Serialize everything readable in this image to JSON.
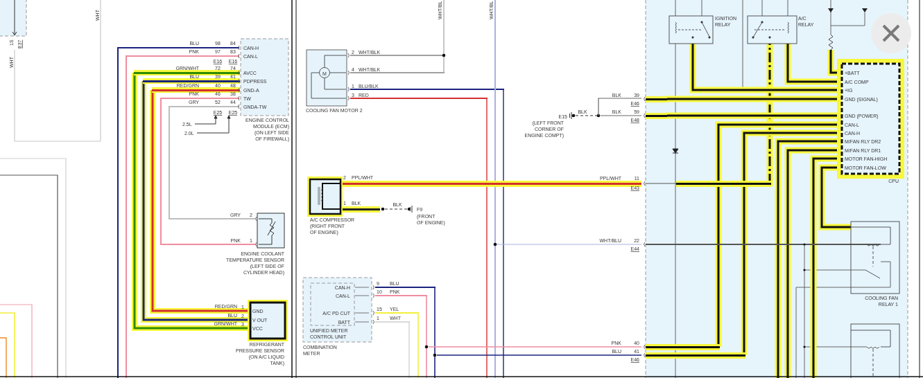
{
  "left_stub": {
    "pin": "1S",
    "connector": "E37",
    "wire_labels": [
      "WHT",
      "WHT"
    ]
  },
  "ecm": {
    "title": "ENGINE CONTROL\nMODULE (ECM)\n(ON LEFT SIDE\nOF FIREWALL)",
    "connectors_upper": [
      "E16",
      "E16"
    ],
    "connectors_lower": [
      "E25",
      "E25"
    ],
    "engine_variants": [
      "2.5L",
      "2.0L"
    ],
    "terminals": [
      {
        "name": "CAN-H",
        "wire": "BLU",
        "pin_harness": "98",
        "pin_module": "84",
        "color": "#1a237e",
        "highlighted": false
      },
      {
        "name": "CAN-L",
        "wire": "PNK",
        "pin_harness": "97",
        "pin_module": "83",
        "color": "#f08ca0",
        "highlighted": false
      },
      {
        "name": "AVCC",
        "wire": "GRN/WHT",
        "pin_harness": "72",
        "pin_module": "74",
        "color": "#2e8b00",
        "highlighted": true
      },
      {
        "name": "PDPRESS",
        "wire": "BLU",
        "pin_harness": "39",
        "pin_module": "41",
        "color": "#1a237e",
        "highlighted": true
      },
      {
        "name": "GND-A",
        "wire": "RED/GRN",
        "pin_harness": "40",
        "pin_module": "48",
        "color": "#d32f2f",
        "highlighted": true
      },
      {
        "name": "TW",
        "wire": "PNK",
        "pin_harness": "46",
        "pin_module": "38",
        "color": "#f08ca0",
        "highlighted": false
      },
      {
        "name": "GNDA-TW",
        "wire": "GRY",
        "pin_harness": "52",
        "pin_module": "44",
        "color": "#bdbdbd",
        "highlighted": false
      }
    ]
  },
  "coolant_sensor": {
    "title": "ENGINE COOLANT\nTEMPERATURE SENSOR\n(LEFT SIDE OF\nCYLINDER HEAD)",
    "pins": [
      {
        "wire": "GRY",
        "pin": "2"
      },
      {
        "wire": "PNK",
        "pin": "1"
      }
    ]
  },
  "pressure_sensor": {
    "title": "REFRIGERANT\nPRESSURE SENSOR\n(ON A/C LIQUID\nTANK)",
    "highlighted": true,
    "pins": [
      {
        "terminal": "GND",
        "wire": "RED/GRN",
        "pin": "1"
      },
      {
        "terminal": "V OUT",
        "wire": "BLU",
        "pin": "2"
      },
      {
        "terminal": "VCC",
        "wire": "GRN/WHT",
        "pin": "3"
      }
    ]
  },
  "fan_motor": {
    "title": "COOLING FAN MOTOR 2",
    "motor_symbol": "M",
    "riser_label": "WHT/BL",
    "pins": [
      {
        "pin": "2",
        "wire": "WHT/BLK",
        "color": "#a0a0a0"
      },
      {
        "pin": "4",
        "wire": "WHT/BLK",
        "color": "#a0a0a0"
      },
      {
        "pin": "1",
        "wire": "BLU/BLK",
        "color": "#1a237e"
      },
      {
        "pin": "3",
        "wire": "RED",
        "color": "#d32f2f"
      }
    ]
  },
  "vertical_wire": {
    "label": "WHT/BL",
    "color": "#a9b0e0"
  },
  "ac_compressor": {
    "title": "A/C COMPRESSOR\n(RIGHT FRONT\nOF ENGINE)",
    "highlighted": true,
    "pins": [
      {
        "pin": "2",
        "wire": "PPL/WHT",
        "color": "#d32f2f"
      },
      {
        "pin": "1",
        "wire": "BLK",
        "color": "#222222"
      }
    ],
    "ground": {
      "wire": "BLK",
      "name": "F9",
      "location": "(FRONT\nOF ENGINE)"
    }
  },
  "ground_e15": {
    "name": "E15",
    "wire": "BLK",
    "location": "(LEFT FRONT\nCORNER OF\nENGINE COMPT)"
  },
  "combination_meter": {
    "title": "COMBINATION\nMETER",
    "unit": "UNIFIED METER\nCONTROL UNIT",
    "terminals": [
      {
        "name": "CAN-H",
        "pin": "9",
        "wire": "BLU",
        "color": "#1a237e"
      },
      {
        "name": "CAN-L",
        "pin": "10",
        "wire": "PNK",
        "color": "#f08ca0"
      },
      {
        "name": "A/C PD CUT",
        "pin": "15",
        "wire": "YEL",
        "color": "#f2f03a"
      },
      {
        "name": "BATT",
        "pin": "1",
        "wire": "WHT",
        "color": "#d8d8d8"
      }
    ]
  },
  "control_module": {
    "connections": [
      {
        "wire": "BLK",
        "pin": "39",
        "connector": "E46",
        "highlighted": true
      },
      {
        "wire": "BLK",
        "pin": "59",
        "connector": "E48",
        "highlighted": true
      },
      {
        "wire": "PPL/WHT",
        "pin": "11",
        "connector": "E43",
        "highlighted": true
      },
      {
        "wire": "WHT/BLU",
        "pin": "22",
        "connector": "E44",
        "highlighted": false
      },
      {
        "wire": "PNK",
        "pin": "40",
        "highlighted": true
      },
      {
        "wire": "BLU",
        "pin": "41",
        "connector": "E46",
        "highlighted": true
      }
    ],
    "relays": [
      {
        "name": "IGNITION\nRELAY"
      },
      {
        "name": "A/C\nRELAY"
      },
      {
        "name": "COOLING FAN\nRELAY 1"
      }
    ],
    "cpu": {
      "label": "CPU",
      "highlighted": true,
      "terminals": [
        "+BATT",
        "A/C COMP",
        "+IG",
        "GND (SIGNAL)",
        "GND (POWER)",
        "CAN-L",
        "CAN-H",
        "M/FAN RLY DR2",
        "M/FAN RLY DR1",
        "MOTOR FAN-HIGH",
        "MOTOR FAN-LOW"
      ]
    }
  }
}
